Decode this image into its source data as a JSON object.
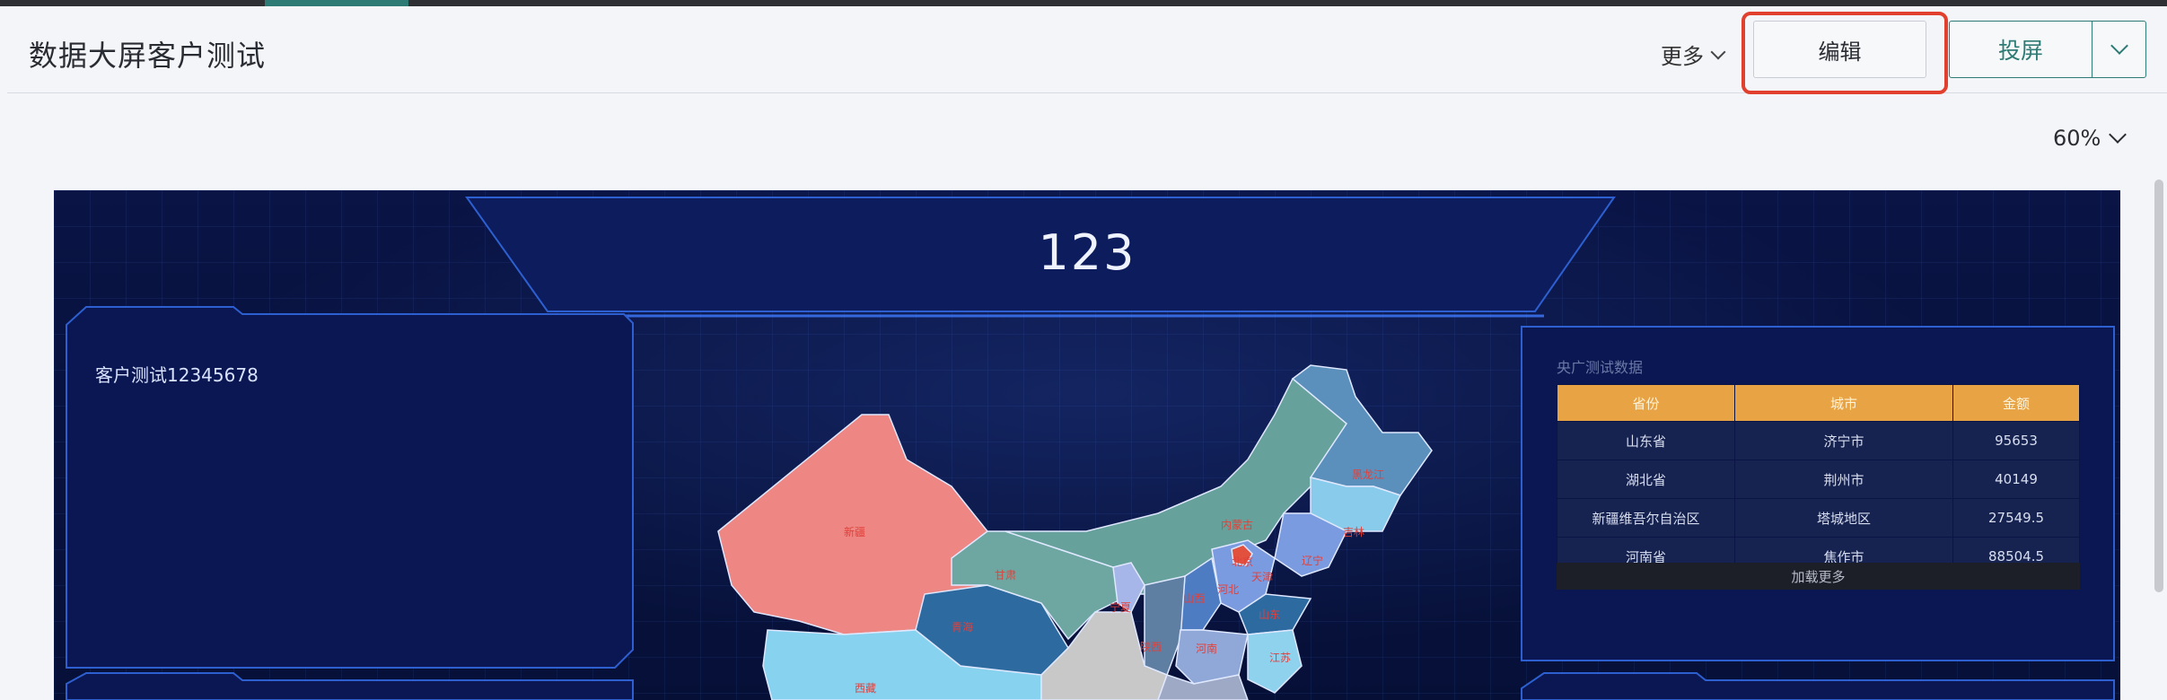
{
  "header": {
    "title": "数据大屏客户测试",
    "more_label": "更多",
    "edit_label": "编辑",
    "cast_label": "投屏"
  },
  "zoom": {
    "label": "60%"
  },
  "screen": {
    "title": "123",
    "left_card": {
      "text": "客户测试12345678"
    },
    "table": {
      "title": "央广测试数据",
      "headers": [
        "省份",
        "城市",
        "金额"
      ],
      "rows": [
        [
          "山东省",
          "济宁市",
          "95653"
        ],
        [
          "湖北省",
          "荆州市",
          "40149"
        ],
        [
          "新疆维吾尔自治区",
          "塔城地区",
          "27549.5"
        ],
        [
          "河南省",
          "焦作市",
          "88504.5"
        ]
      ],
      "load_more": "加载更多"
    },
    "map_labels": {
      "xinjiang": "新疆",
      "qinghai": "青海",
      "gansu": "甘肃",
      "neimenggu": "内蒙古",
      "heilongjiang": "黑龙江",
      "jilin": "吉林",
      "liaoning": "辽宁",
      "hebei": "河北",
      "beijing": "北京",
      "tianjin": "天津",
      "shanxi": "山西",
      "shandong": "山东",
      "ningxia": "宁夏",
      "shaanxi": "陕西",
      "henan": "河南",
      "jiangsu": "江苏",
      "xizang": "西藏"
    }
  },
  "colors": {
    "accent": "#2e7b76",
    "highlight": "#e2402f",
    "table_header": "#e8a345",
    "screen_bg": "#0a1445"
  }
}
